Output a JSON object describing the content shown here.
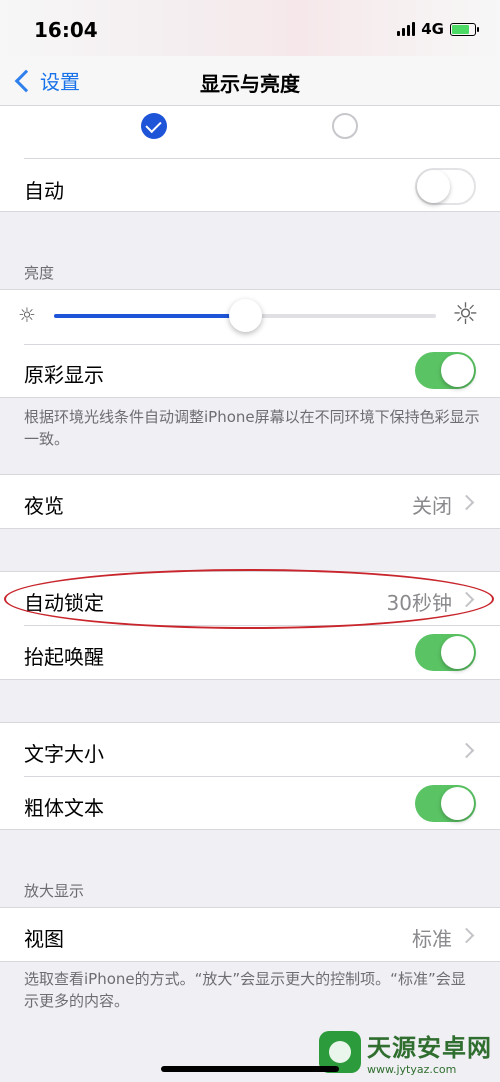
{
  "status_bar": {
    "time": "16:04",
    "network": "4G"
  },
  "nav": {
    "back_label": "设置",
    "title": "显示与亮度"
  },
  "appearance": {
    "auto_label": "自动",
    "auto_on": false
  },
  "brightness": {
    "header": "亮度",
    "level_percent": 50,
    "true_tone_label": "原彩显示",
    "true_tone_on": true,
    "footer": "根据环境光线条件自动调整iPhone屏幕以在不同环境下保持色彩显示一致。"
  },
  "night_shift": {
    "label": "夜览",
    "value": "关闭"
  },
  "lock": {
    "auto_lock_label": "自动锁定",
    "auto_lock_value": "30秒钟",
    "raise_to_wake_label": "抬起唤醒",
    "raise_to_wake_on": true
  },
  "text": {
    "text_size_label": "文字大小",
    "bold_text_label": "粗体文本",
    "bold_text_on": true
  },
  "zoom": {
    "header": "放大显示",
    "view_label": "视图",
    "view_value": "标准",
    "footer": "选取查看iPhone的方式。“放大”会显示更大的控制项。“标准”会显示更多的内容。"
  },
  "watermark": {
    "title": "天源安卓网",
    "url": "www.jytyaz.com"
  },
  "colors": {
    "accent": "#1e54d8",
    "toggle_on": "#5ac363",
    "annotation": "#c8262c"
  }
}
